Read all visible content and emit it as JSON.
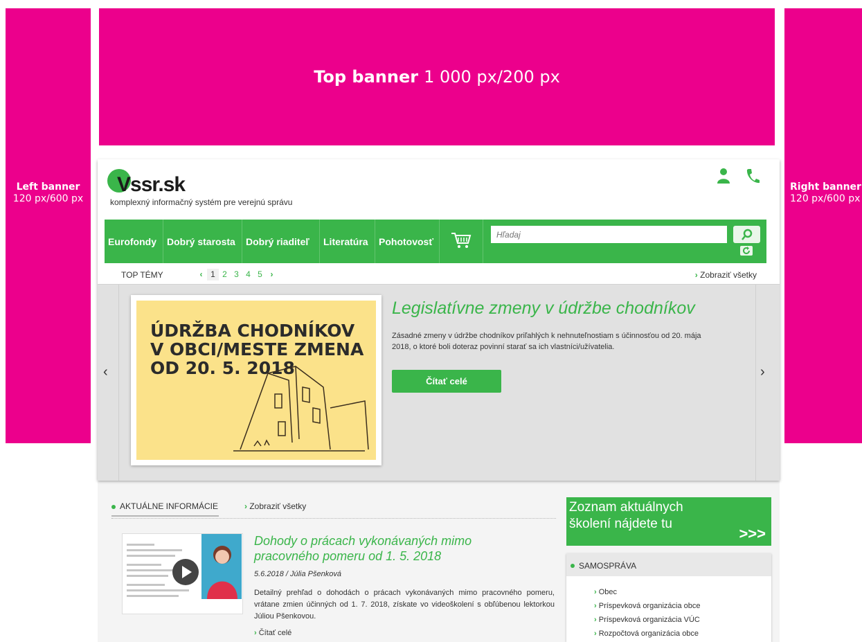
{
  "banners": {
    "top": {
      "bold": "Top banner",
      "size": "1 000 px/200 px"
    },
    "left": {
      "bold": "Left banner",
      "size": "120 px/600 px"
    },
    "right": {
      "bold": "Right banner",
      "size": "120 px/600 px"
    }
  },
  "header": {
    "logo": "Vssr.sk",
    "tagline": "komplexný informačný systém pre verejnú správu",
    "icons": [
      "user-icon",
      "phone-icon"
    ]
  },
  "nav": {
    "items": [
      "Eurofondy",
      "Dobrý starosta",
      "Dobrý riaditeľ",
      "Literatúra",
      "Pohotovosť"
    ],
    "search_placeholder": "Hľadaj"
  },
  "topics": {
    "label": "TOP TÉMY",
    "pages": [
      "1",
      "2",
      "3",
      "4",
      "5"
    ],
    "active_page": "1",
    "show_all": "Zobraziť všetky"
  },
  "slide": {
    "image_text": "ÚDRŽBA CHODNÍKOV V OBCI/MESTE ZMENA OD 20. 5. 2018",
    "title": "Legislatívne zmeny v údržbe chodníkov",
    "description": "Zásadné zmeny v údržbe chodníkov priľahlých k nehnuteľnostiam s účinnosťou od 20. mája 2018, o ktoré boli doteraz povinní starať sa ich vlastníci/užívatelia.",
    "button": "Čítať celé"
  },
  "news": {
    "heading": "AKTUÁLNE INFORMÁCIE",
    "show_all": "Zobraziť všetky",
    "article": {
      "title": "Dohody o prácach vykonávaných mimo pracovného pomeru od 1. 5. 2018",
      "date": "5.6.2018",
      "author": "Júlia Pšenková",
      "text": "Detailný prehľad o dohodách o prácach vykonávaných mimo pracovného pomeru, vrátane zmien účinných od 1. 7. 2018, získate vo videoškolení s obľúbenou lektorkou Júliou Pšenkovou.",
      "more": "Čítať celé"
    }
  },
  "promo": {
    "line1": "Zoznam aktuálnych",
    "line2": "školení nájdete tu",
    "arrows": ">>>"
  },
  "samosprava": {
    "heading": "SAMOSPRÁVA",
    "items": [
      "Obec",
      "Príspevková organizácia obce",
      "Príspevková organizácia VÚC",
      "Rozpočtová organizácia obce"
    ]
  },
  "colors": {
    "brand_green": "#3ab54a",
    "banner_magenta": "#ec008c"
  }
}
